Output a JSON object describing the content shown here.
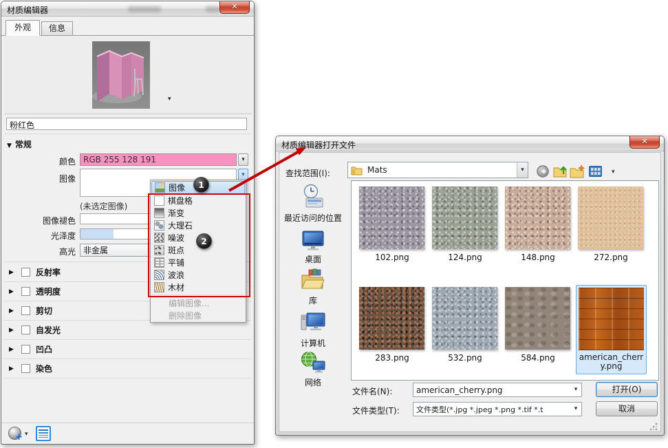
{
  "icons": {
    "close": "✕",
    "dropdown_arrow": "▾",
    "expander_collapsed": "▶",
    "expander_expanded": "▼"
  },
  "material_editor": {
    "title": "材质编辑器",
    "tabs": [
      {
        "label": "外观",
        "active": true
      },
      {
        "label": "信息",
        "active": false
      }
    ],
    "material_name": "粉红色",
    "general": {
      "header": "常规",
      "color_label": "颜色",
      "color_value": "RGB 255 128 191",
      "color_hex": "#FF80BF",
      "image_label": "图像",
      "no_image_text": "(未选定图像)",
      "image_fade_label": "图像褪色",
      "glossiness_label": "光泽度",
      "highlight_label": "高光",
      "highlight_value": "非金属"
    },
    "sections": [
      "反射率",
      "透明度",
      "剪切",
      "自发光",
      "凹凸",
      "染色"
    ],
    "menu": {
      "items": [
        "图像",
        "棋盘格",
        "渐变",
        "大理石",
        "噪波",
        "斑点",
        "平铺",
        "波浪",
        "木材"
      ],
      "selected_item": "图像",
      "disabled_items": [
        "编辑图像...",
        "删除图像"
      ]
    },
    "callouts": [
      "1",
      "2"
    ],
    "annotation_color": "#CC0000"
  },
  "open_dialog": {
    "title": "材质编辑器打开文件",
    "look_in_label": "查找范围(I):",
    "look_in_value": "Mats",
    "places": [
      "最近访问的位置",
      "桌面",
      "库",
      "计算机",
      "网络"
    ],
    "files": [
      {
        "name": "102.png",
        "base_color": "#9C95A2"
      },
      {
        "name": "124.png",
        "base_color": "#99A193"
      },
      {
        "name": "148.png",
        "base_color": "#C9AB97"
      },
      {
        "name": "272.png",
        "base_color": "#DFC09B"
      },
      {
        "name": "283.png",
        "base_color": "#6D5342"
      },
      {
        "name": "532.png",
        "base_color": "#9DA8B3"
      },
      {
        "name": "584.png",
        "base_color": "#92857A"
      },
      {
        "name": "american_cherry.png",
        "base_color": "#B05518",
        "selected": true
      }
    ],
    "file_name_label": "文件名(N):",
    "file_name_value": "american_cherry.png",
    "file_type_label": "文件类型(T):",
    "file_type_value": "文件类型(*.jpg *.jpeg *.png *.tif *.t",
    "open_button": "打开(O)",
    "cancel_button": "取消"
  }
}
